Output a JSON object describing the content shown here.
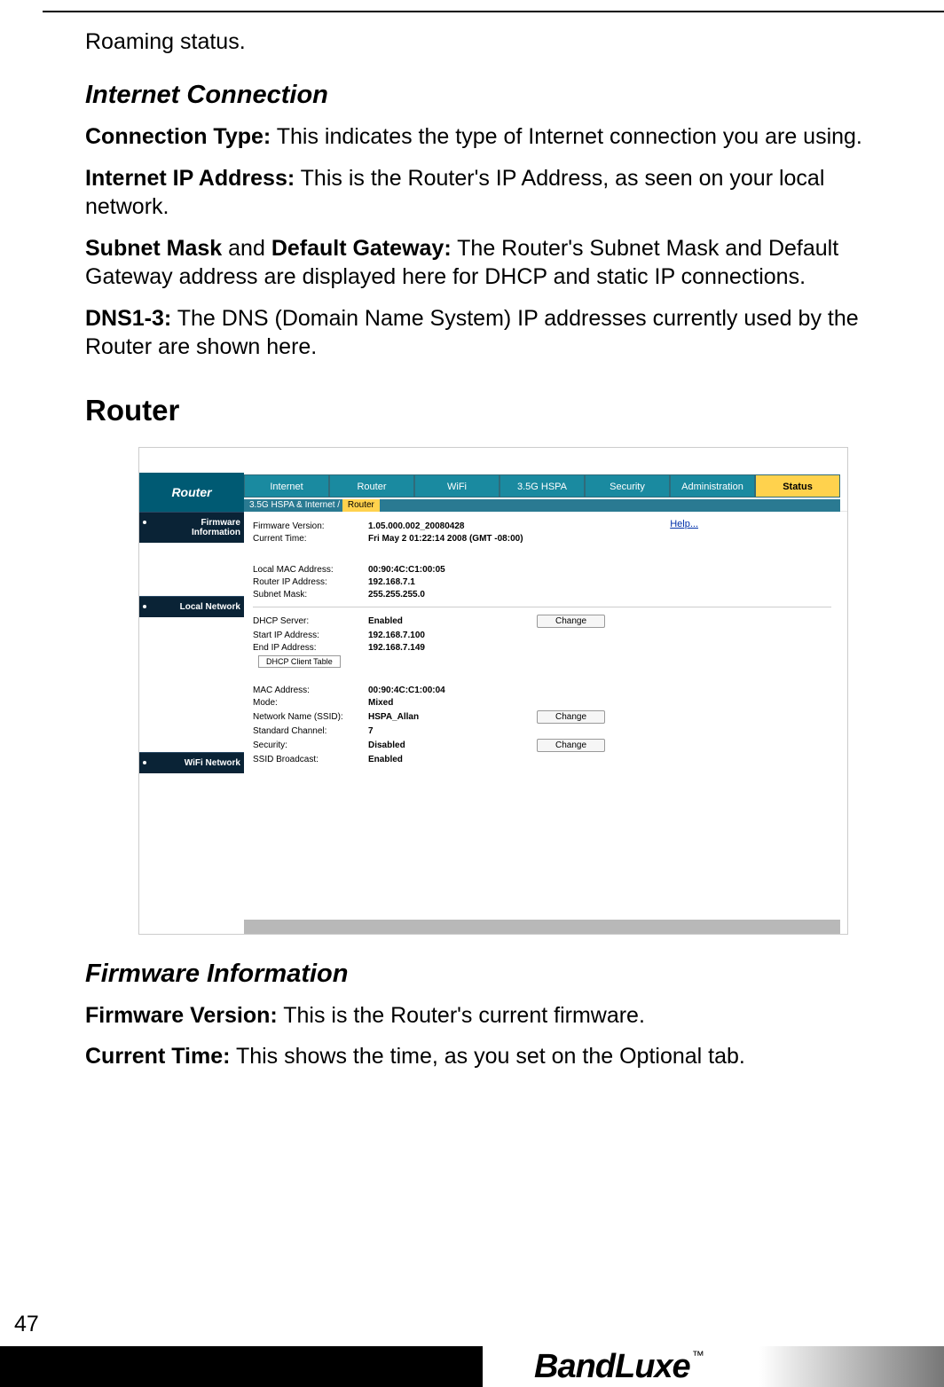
{
  "top_text": "Roaming status.",
  "sect_ic": {
    "heading": "Internet Connection",
    "paras": [
      {
        "b": "Connection Type:",
        "t": " This indicates the type of Internet connection you are using."
      },
      {
        "b": "Internet IP Address:",
        "t": " This is the Router's IP Address, as seen on your local network."
      },
      {
        "b": "Subnet Mask",
        "mid": " and ",
        "b2": "Default Gateway:",
        "t": " The Router's Subnet Mask and Default Gateway address are displayed here for DHCP and static IP connections."
      },
      {
        "b": "DNS1-3:",
        "t": " The DNS (Domain Name System) IP addresses currently used by the Router are shown here."
      }
    ]
  },
  "sect_router_heading": "Router",
  "figure": {
    "title": "Router",
    "tabs": [
      "Internet",
      "Router",
      "WiFi",
      "3.5G HSPA",
      "Security",
      "Administration",
      "Status"
    ],
    "tabs_selected_index": 6,
    "breadcrumb_prefix": "3.5G HSPA & Internet  /",
    "breadcrumb_current": "Router",
    "side": [
      "Firmware Information",
      "Local Network",
      "WiFi Network"
    ],
    "help": "Help...",
    "rows_fw": [
      {
        "lbl": "Firmware Version:",
        "val": "1.05.000.002_20080428"
      },
      {
        "lbl": "Current Time:",
        "val": "Fri May 2 01:22:14 2008 (GMT -08:00)"
      }
    ],
    "rows_ln1": [
      {
        "lbl": "Local MAC Address:",
        "val": "00:90:4C:C1:00:05"
      },
      {
        "lbl": "Router IP Address:",
        "val": "192.168.7.1"
      },
      {
        "lbl": "Subnet Mask:",
        "val": "255.255.255.0"
      }
    ],
    "rows_ln2": [
      {
        "lbl": "DHCP Server:",
        "val": "Enabled",
        "btn": "Change"
      },
      {
        "lbl": "Start IP Address:",
        "val": "192.168.7.100"
      },
      {
        "lbl": "End IP Address:",
        "val": "192.168.7.149"
      }
    ],
    "dhcp_btn": "DHCP Client Table",
    "rows_wifi": [
      {
        "lbl": "MAC Address:",
        "val": "00:90:4C:C1:00:04"
      },
      {
        "lbl": "Mode:",
        "val": "Mixed"
      },
      {
        "lbl": "Network Name (SSID):",
        "val": "HSPA_Allan",
        "btn": "Change"
      },
      {
        "lbl": "Standard Channel:",
        "val": "7"
      },
      {
        "lbl": "Security:",
        "val": "Disabled",
        "btn": "Change"
      },
      {
        "lbl": "SSID Broadcast:",
        "val": "Enabled"
      }
    ]
  },
  "sect_fw": {
    "heading": "Firmware Information",
    "paras": [
      {
        "b": "Firmware Version:",
        "t": " This is the Router's current firmware."
      },
      {
        "b": "Current Time:",
        "t": " This shows the time, as you set on the Optional tab."
      }
    ]
  },
  "page_number": "47",
  "brand": "BandLuxe",
  "brand_tm": "™"
}
